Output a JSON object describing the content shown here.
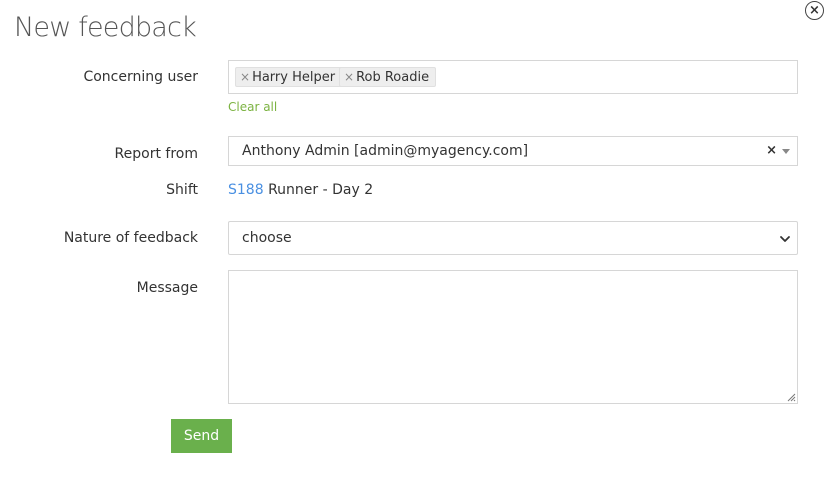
{
  "dialog": {
    "title": "New feedback"
  },
  "form": {
    "concerning_user": {
      "label": "Concerning user",
      "tags": [
        "Harry Helper",
        "Rob Roadie"
      ],
      "remove_glyph": "×",
      "clear_all": "Clear all"
    },
    "report_from": {
      "label": "Report from",
      "value": "Anthony Admin [admin@myagency.com]",
      "clear_glyph": "×"
    },
    "shift": {
      "label": "Shift",
      "code": "S188",
      "name": "Runner - Day 2"
    },
    "nature": {
      "label": "Nature of feedback",
      "value": "choose"
    },
    "message": {
      "label": "Message",
      "value": ""
    },
    "send_label": "Send"
  },
  "colors": {
    "accent_green": "#6ab04c",
    "link_green": "#7cb342",
    "link_blue": "#4a90e2",
    "border": "#d6d6d6"
  },
  "icons": {
    "close": "close-circle-icon",
    "dropdown": "caret-down-icon",
    "select_chevron": "chevron-down-icon",
    "resize": "resize-grip-icon"
  }
}
